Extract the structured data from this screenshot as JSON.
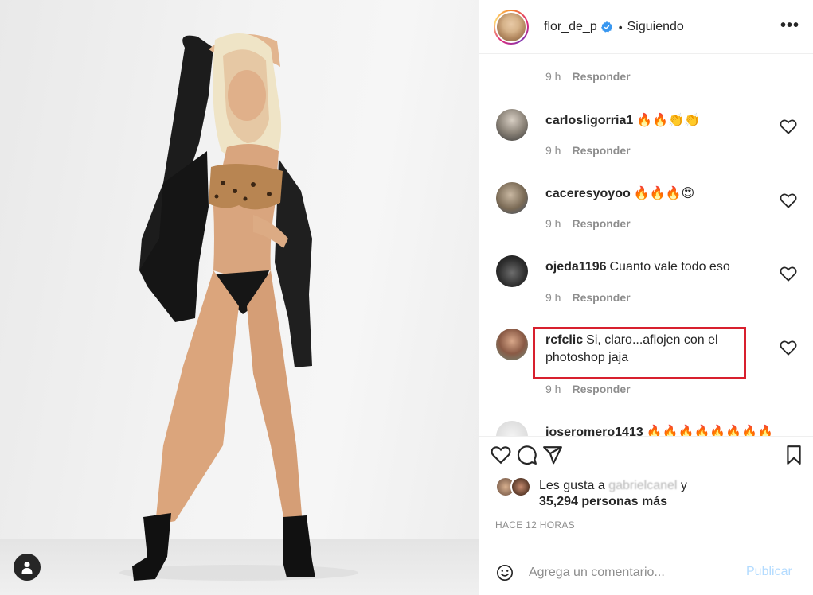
{
  "post": {
    "username": "flor_de_p",
    "separator": "•",
    "follow_status": "Siguiendo",
    "more_label": "•••"
  },
  "comments": [
    {
      "user": "",
      "text": "",
      "time": "9 h",
      "reply": "Responder"
    },
    {
      "user": "carlosligorria1",
      "text": "🔥🔥👏👏",
      "time": "9 h",
      "reply": "Responder"
    },
    {
      "user": "caceresyoyoo",
      "text": "🔥🔥🔥😍",
      "time": "9 h",
      "reply": "Responder"
    },
    {
      "user": "ojeda1196",
      "text": "Cuanto vale todo eso",
      "time": "9 h",
      "reply": "Responder"
    },
    {
      "user": "rcfclic",
      "text": "Si, claro...aflojen con el photoshop jaja",
      "time": "9 h",
      "reply": "Responder"
    },
    {
      "user": "joseromero1413",
      "text": "🔥🔥🔥🔥🔥🔥🔥🔥",
      "time": "",
      "reply": ""
    }
  ],
  "likes": {
    "prefix": "Les gusta a",
    "liker": "gabrielcanel",
    "suffix": "y",
    "count_text": "35,294 personas más"
  },
  "timestamp": "HACE 12 HORAS",
  "add_comment": {
    "placeholder": "Agrega un comentario...",
    "publish_label": "Publicar"
  },
  "icons": {
    "verified": "verified-badge-icon",
    "more": "more-options-icon",
    "heart": "heart-icon",
    "comment": "comment-icon",
    "share": "share-icon",
    "save": "bookmark-icon",
    "emoji": "emoji-icon",
    "tag": "user-tag-icon"
  },
  "colors": {
    "verified": "#3897f0",
    "highlight_box": "#d8202e",
    "publish_disabled": "#b3dbff",
    "secondary_text": "#8e8e8e"
  }
}
